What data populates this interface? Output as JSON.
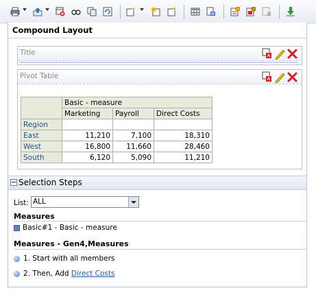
{
  "toolbar": {
    "buttons": [
      {
        "name": "print-icon"
      },
      {
        "name": "export-icon"
      },
      {
        "name": "delete-view-icon"
      },
      {
        "name": "preview-icon"
      },
      {
        "name": "copy-view-icon"
      },
      {
        "name": "refresh-icon"
      },
      {
        "name": "new-view-icon"
      },
      {
        "name": "insert-view-icon"
      },
      {
        "name": "add-view-icon"
      },
      {
        "name": "table-view-icon"
      },
      {
        "name": "filter-icon"
      },
      {
        "name": "properties-icon"
      },
      {
        "name": "settings-icon"
      },
      {
        "name": "remove-icon"
      },
      {
        "name": "download-icon"
      }
    ]
  },
  "compound": {
    "title": "Compound Layout"
  },
  "views": {
    "title_view": {
      "label": "Title"
    },
    "pivot_view": {
      "label": "Pivot Table"
    }
  },
  "pivot": {
    "measure_header": "Basic - measure",
    "columns": [
      "Marketing",
      "Payroll",
      "Direct Costs"
    ],
    "row_header": "Region",
    "rows": [
      {
        "label": "East",
        "values": [
          "11,210",
          "7,100",
          "18,310"
        ]
      },
      {
        "label": "West",
        "values": [
          "16,800",
          "11,660",
          "28,460"
        ]
      },
      {
        "label": "South",
        "values": [
          "6,120",
          "5,090",
          "11,210"
        ]
      }
    ]
  },
  "selection_steps": {
    "title": "Selection Steps",
    "list_label": "List:",
    "list_value": "ALL",
    "measures_heading": "Measures",
    "measure_item": "Basic#1 - Basic - measure",
    "gen_heading": "Measures - Gen4,Measures",
    "step1": "1. Start with all members",
    "step2_prefix": "2. Then, Add ",
    "step2_link": "Direct Costs"
  },
  "colors": {
    "accent": "#1f5db3",
    "table_header_bg": "#e9ebda",
    "delete_red": "#d62020"
  }
}
